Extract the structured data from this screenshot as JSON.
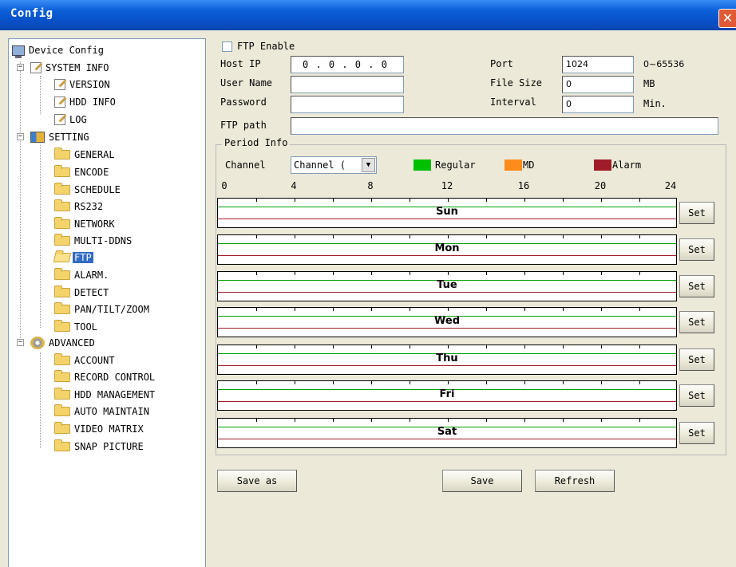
{
  "window": {
    "title": "Config",
    "close_glyph": "✕"
  },
  "tree": {
    "root": "Device Config",
    "items": [
      "SYSTEM INFO",
      "VERSION",
      "HDD INFO",
      "LOG",
      "SETTING",
      "GENERAL",
      "ENCODE",
      "SCHEDULE",
      "RS232",
      "NETWORK",
      "MULTI-DDNS",
      "FTP",
      "ALARM.",
      "DETECT",
      "PAN/TILT/ZOOM",
      "TOOL",
      "ADVANCED",
      "ACCOUNT",
      "RECORD CONTROL",
      "HDD MANAGEMENT",
      "AUTO MAINTAIN",
      "VIDEO MATRIX",
      "SNAP PICTURE"
    ],
    "selected": "FTP"
  },
  "form": {
    "ftp_enable_label": "FTP Enable",
    "host_ip_label": "Host IP",
    "host_ip_value": "0 . 0 . 0 . 0",
    "user_name_label": "User Name",
    "user_name_value": "",
    "password_label": "Password",
    "password_value": "",
    "ftp_path_label": "FTP path",
    "ftp_path_value": "",
    "port_label": "Port",
    "port_value": "1024",
    "port_range": "0~65536",
    "file_size_label": "File Size",
    "file_size_value": "0",
    "file_size_unit": "MB",
    "interval_label": "Interval",
    "interval_value": "0",
    "interval_unit": "Min."
  },
  "period": {
    "legend": "Period Info",
    "channel_label": "Channel",
    "channel_value": "Channel (",
    "legend_items": [
      {
        "label": "Regular",
        "color": "#00c000"
      },
      {
        "label": "MD",
        "color": "#ff8c1a"
      },
      {
        "label": "Alarm",
        "color": "#a01c28"
      }
    ],
    "hours": [
      "0",
      "4",
      "8",
      "12",
      "16",
      "20",
      "24"
    ],
    "days": [
      "Sun",
      "Mon",
      "Tue",
      "Wed",
      "Thu",
      "Fri",
      "Sat"
    ],
    "set_label": "Set",
    "line_colors": {
      "regular": "#00a000",
      "alarm": "#a01c28"
    }
  },
  "buttons": {
    "save_as": "Save as",
    "save": "Save",
    "refresh": "Refresh"
  }
}
